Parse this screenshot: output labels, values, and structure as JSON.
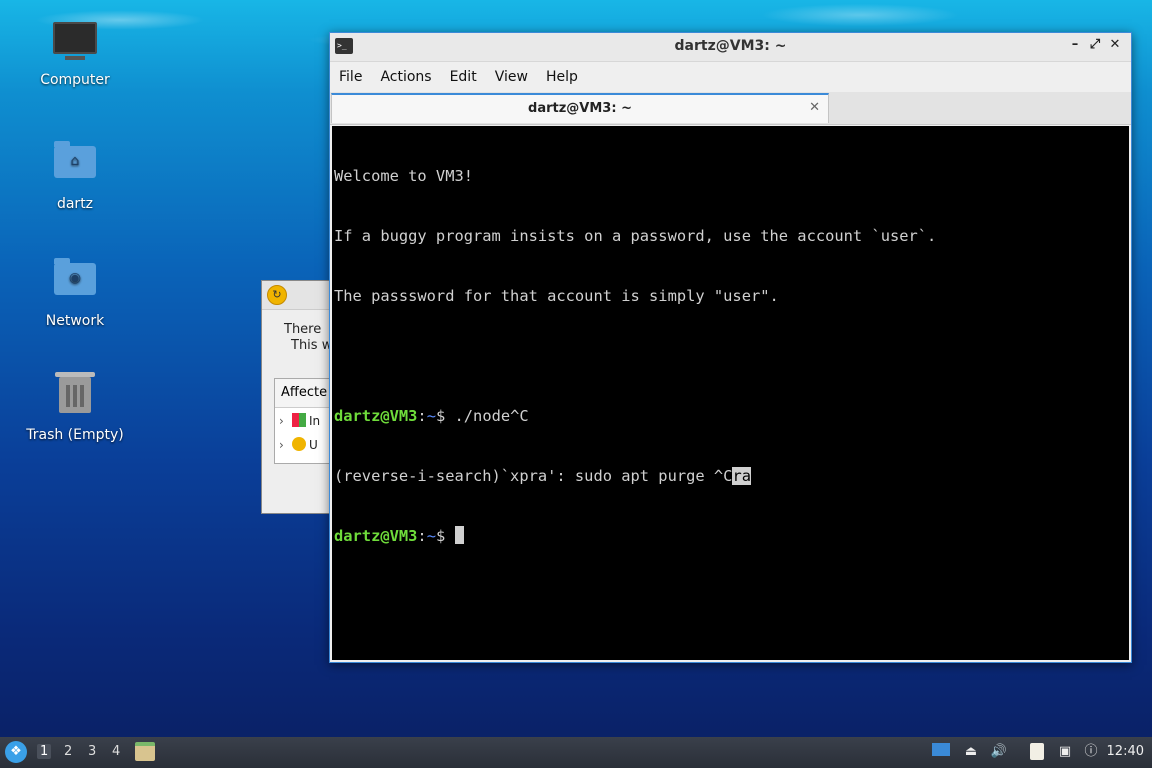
{
  "desktop": {
    "icons": [
      {
        "label": "Computer",
        "icon": "monitor-icon"
      },
      {
        "label": "dartz",
        "icon": "home-folder-icon"
      },
      {
        "label": "Network",
        "icon": "network-folder-icon"
      },
      {
        "label": "Trash (Empty)",
        "icon": "trash-icon"
      }
    ]
  },
  "dialog": {
    "text_line1": "There",
    "text_line2": "This w",
    "affected_header": "Affecte",
    "rows": [
      {
        "label": "In",
        "icon": "package-install-icon"
      },
      {
        "label": "U",
        "icon": "update-icon"
      }
    ]
  },
  "terminal": {
    "title": "dartz@VM3: ~",
    "menu": [
      "File",
      "Actions",
      "Edit",
      "View",
      "Help"
    ],
    "tab_label": "dartz@VM3: ~",
    "lines": {
      "l1": "Welcome to VM3!",
      "l2": "If a buggy program insists on a password, use the account `user`.",
      "l3": "The passsword for that account is simply \"user\".",
      "prompt_user": "dartz@VM3",
      "prompt_sep": ":",
      "prompt_path": "~",
      "prompt_end": "$ ",
      "cmd1": "./node^C",
      "search_prefix": "(reverse-i-search)`xpra': sudo apt purge ^C",
      "search_match": "ra"
    }
  },
  "taskbar": {
    "workspaces": [
      "1",
      "2",
      "3",
      "4"
    ],
    "active_workspace": "1",
    "clock": "12:40",
    "tray_icons": [
      "show-desktop-icon",
      "eject-icon",
      "volume-icon",
      "clipboard-icon",
      "network-wired-icon",
      "notification-icon"
    ]
  },
  "colors": {
    "accent": "#3b8ad8",
    "prompt_user": "#6fdc3b",
    "prompt_path": "#5a8cff"
  }
}
